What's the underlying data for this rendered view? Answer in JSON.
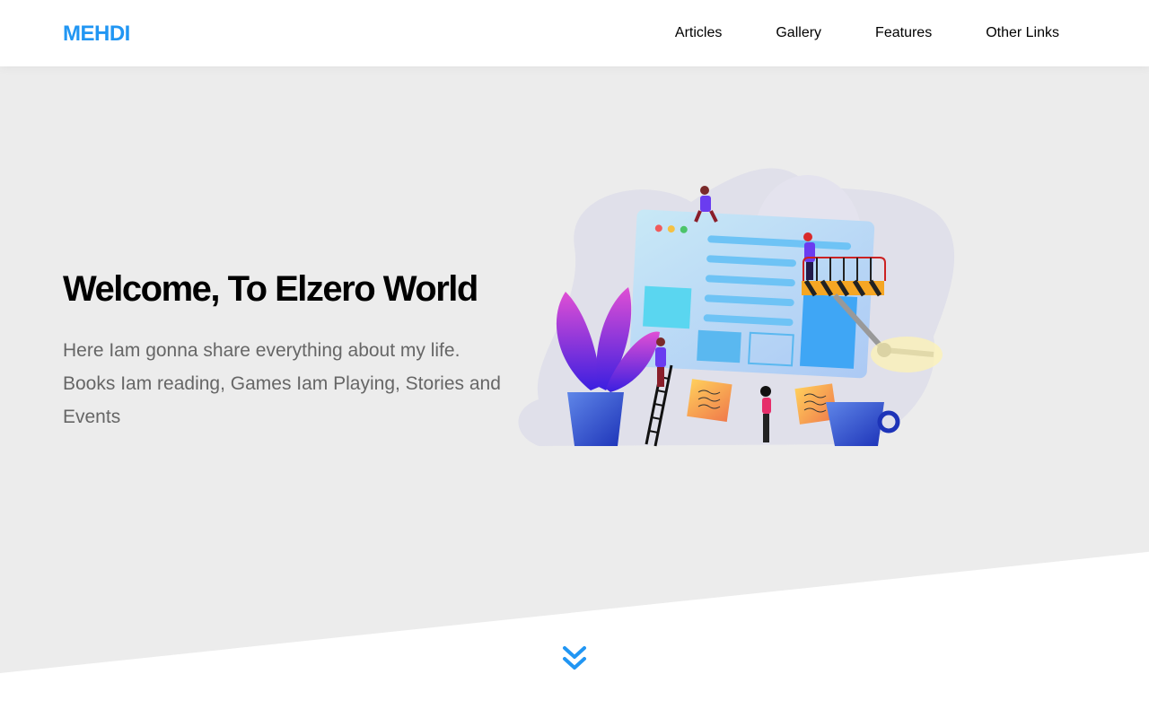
{
  "header": {
    "logo": "MEHDI",
    "nav": [
      {
        "label": "Articles"
      },
      {
        "label": "Gallery"
      },
      {
        "label": "Features"
      },
      {
        "label": "Other Links"
      }
    ]
  },
  "landing": {
    "title": "Welcome, To Elzero World",
    "description": "Here Iam gonna share everything about my life. Books Iam reading, Games Iam Playing, Stories and Events",
    "illustration_icon": "web-design-team-illustration",
    "go_down_icon": "angle-double-down-icon"
  },
  "colors": {
    "accent": "#2196f3",
    "landing_bg": "#ececec",
    "text_muted": "#666666"
  }
}
